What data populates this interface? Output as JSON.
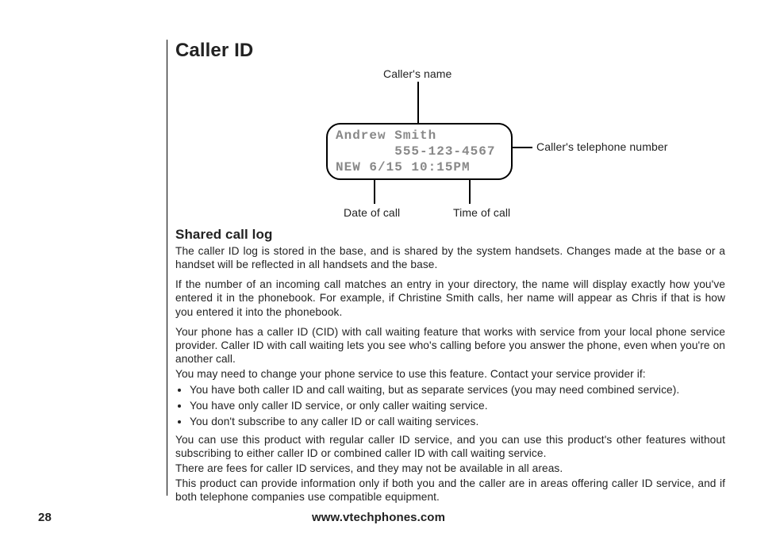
{
  "page": {
    "number": "28",
    "url": "www.vtechphones.com"
  },
  "title": "Caller ID",
  "diagram": {
    "labels": {
      "caller_name": "Caller's name",
      "phone_number": "Caller's telephone number",
      "date": "Date of call",
      "time": "Time of call"
    },
    "lcd": {
      "name": "Andrew Smith",
      "number": "555-123-4567",
      "status_line": "NEW 6/15 10:15PM"
    }
  },
  "section": {
    "heading": "Shared call log",
    "p1": "The caller ID log is stored in the base, and is shared by the system handsets. Changes made at the base or a handset will be reflected in all handsets and the base.",
    "p2": "If the number of an incoming call matches an entry in your directory, the name will display exactly how you've entered it in the phonebook. For example, if Christine Smith calls, her name will appear as Chris if that is how you entered it into the phonebook.",
    "p3": "Your phone has a caller ID (CID) with call waiting feature that works with service from your local phone service provider. Caller ID with call waiting lets you see who's calling before you answer the phone, even when you're on another call.",
    "p4": "You may need to change your phone service to use this feature. Contact your service provider if:",
    "bullets": [
      "You have both caller ID and call waiting, but as separate services (you may need combined service).",
      "You have only caller ID service, or only caller waiting service.",
      "You don't subscribe to any caller ID or call waiting services."
    ],
    "p5": "You can use this product with regular caller ID service, and you can use this product's other features without subscribing to either caller ID or combined caller ID with call waiting service.",
    "p6": "There are fees for caller ID services, and they may not be available in all areas.",
    "p7": "This product can provide information only if both you and the caller are in areas offering caller ID service, and if both telephone companies use compatible equipment."
  }
}
